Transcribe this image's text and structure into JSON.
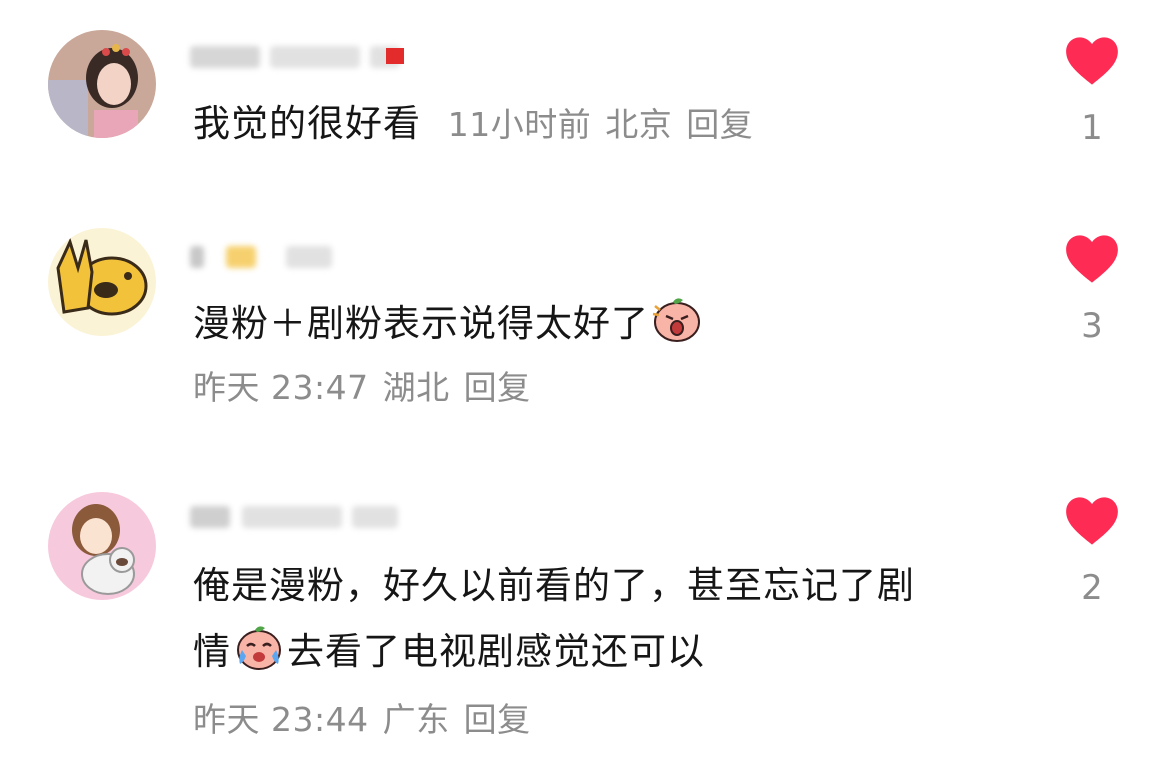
{
  "comments": [
    {
      "text": "我觉的很好看",
      "time": "11小时前",
      "location": "北京",
      "reply_label": "回复",
      "likes": "1",
      "avatar_icon": "girl-portrait-avatar",
      "name_blurred": true
    },
    {
      "text": "漫粉＋剧粉表示说得太好了",
      "emoji": "shouting-peach-emoji",
      "time": "昨天 23:47",
      "location": "湖北",
      "reply_label": "回复",
      "likes": "3",
      "avatar_icon": "yellow-dog-peace-sign-avatar",
      "name_blurred": true
    },
    {
      "text_line1": "俺是漫粉，好久以前看的了，甚至忘记了剧",
      "text_line2_prefix": "情",
      "emoji": "crying-peach-emoji",
      "text_line2_suffix": "去看了电视剧感觉还可以",
      "time": "昨天 23:44",
      "location": "广东",
      "reply_label": "回复",
      "likes": "2",
      "avatar_icon": "anime-girl-with-cat-avatar",
      "name_blurred": true
    }
  ],
  "colors": {
    "heart": "#fe2c55",
    "meta": "#8c8c8c",
    "text": "#161616"
  }
}
